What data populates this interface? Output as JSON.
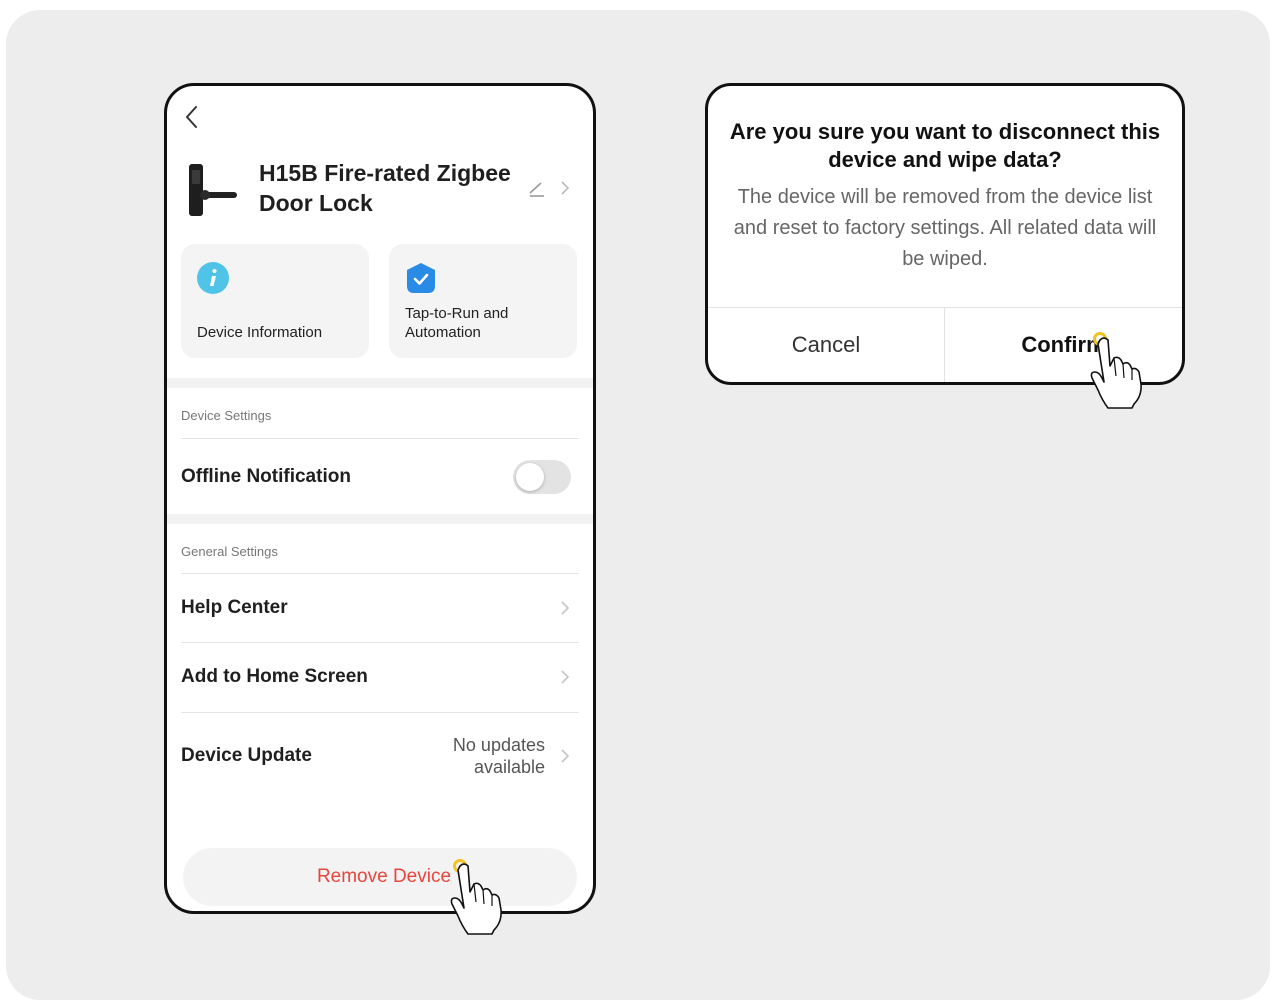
{
  "device": {
    "title": "H15B Fire-rated Zigbee Door Lock",
    "image_icon": "door-lock-image"
  },
  "cards": [
    {
      "label": "Device Information",
      "icon": "info-icon",
      "icon_color": "#4fc3e8"
    },
    {
      "label": "Tap-to-Run and Automation",
      "icon": "check-shield-icon",
      "icon_color": "#2a8be6"
    }
  ],
  "sections": {
    "device_settings": "Device Settings",
    "general_settings": "General Settings"
  },
  "rows": {
    "offline_notification": {
      "label": "Offline Notification",
      "toggle_on": false
    },
    "help_center": {
      "label": "Help Center"
    },
    "add_home": {
      "label": "Add to Home Screen"
    },
    "device_update": {
      "label": "Device Update",
      "status": "No updates available"
    }
  },
  "remove_device": {
    "label": "Remove Device",
    "color": "#e8453c"
  },
  "dialog": {
    "title": "Are you sure you want to disconnect this device and wipe data?",
    "message": "The device will be removed from the device list and reset to factory settings. All related data will be wiped.",
    "cancel_label": "Cancel",
    "confirm_label": "Confirm"
  },
  "annotations": {
    "tap_indicator_color": "#f3c321",
    "pointer_icon": "hand-pointer-icon"
  }
}
